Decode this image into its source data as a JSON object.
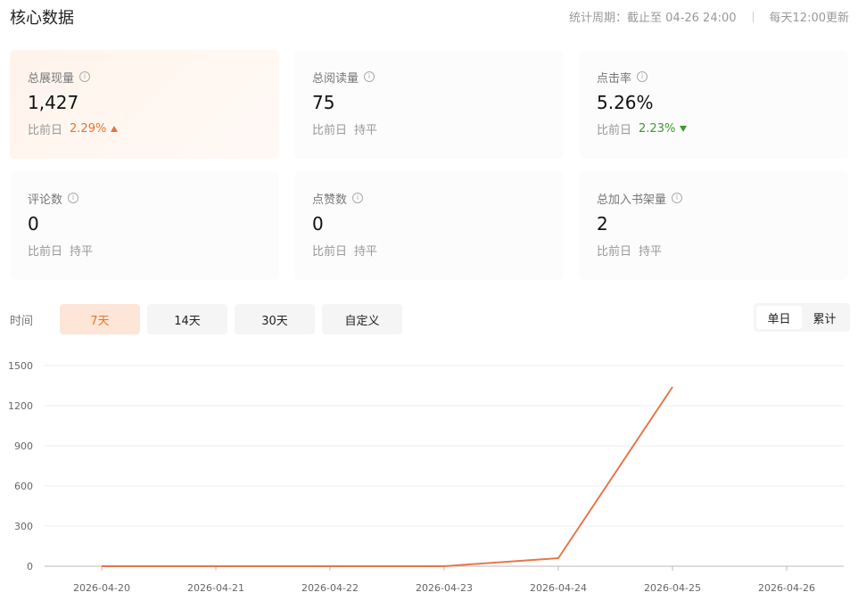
{
  "header": {
    "title": "核心数据",
    "period_text": "统计周期：截止至 04-26 24:00",
    "update_text": "每天12:00更新"
  },
  "metrics": [
    {
      "label": "总展现量",
      "value": "1,427",
      "compare_label": "比前日",
      "delta": "2.29%",
      "trend": "up"
    },
    {
      "label": "总阅读量",
      "value": "75",
      "compare_label": "比前日",
      "delta": "持平",
      "trend": "flat"
    },
    {
      "label": "点击率",
      "value": "5.26%",
      "compare_label": "比前日",
      "delta": "2.23%",
      "trend": "down"
    },
    {
      "label": "评论数",
      "value": "0",
      "compare_label": "比前日",
      "delta": "持平",
      "trend": "flat"
    },
    {
      "label": "点赞数",
      "value": "0",
      "compare_label": "比前日",
      "delta": "持平",
      "trend": "flat"
    },
    {
      "label": "总加入书架量",
      "value": "2",
      "compare_label": "比前日",
      "delta": "持平",
      "trend": "flat"
    }
  ],
  "filters": {
    "time_label": "时间",
    "ranges": [
      "7天",
      "14天",
      "30天",
      "自定义"
    ],
    "selected_range": "7天"
  },
  "mode_toggle": {
    "options": [
      "单日",
      "累计"
    ],
    "selected": "单日"
  },
  "colors": {
    "accent": "#e8742f",
    "up": "#e8742f",
    "down": "#3c9a2c",
    "line": "#e8764a"
  },
  "chart_data": {
    "type": "line",
    "categories": [
      "2026-04-20",
      "2026-04-21",
      "2026-04-22",
      "2026-04-23",
      "2026-04-24",
      "2026-04-25",
      "2026-04-26"
    ],
    "series": [
      {
        "values": [
          0,
          0,
          0,
          0,
          60,
          1340,
          null
        ]
      }
    ],
    "yticks": [
      0,
      300,
      600,
      900,
      1200,
      1500
    ],
    "ylim": [
      0,
      1500
    ],
    "grid": true,
    "legend": "none"
  }
}
